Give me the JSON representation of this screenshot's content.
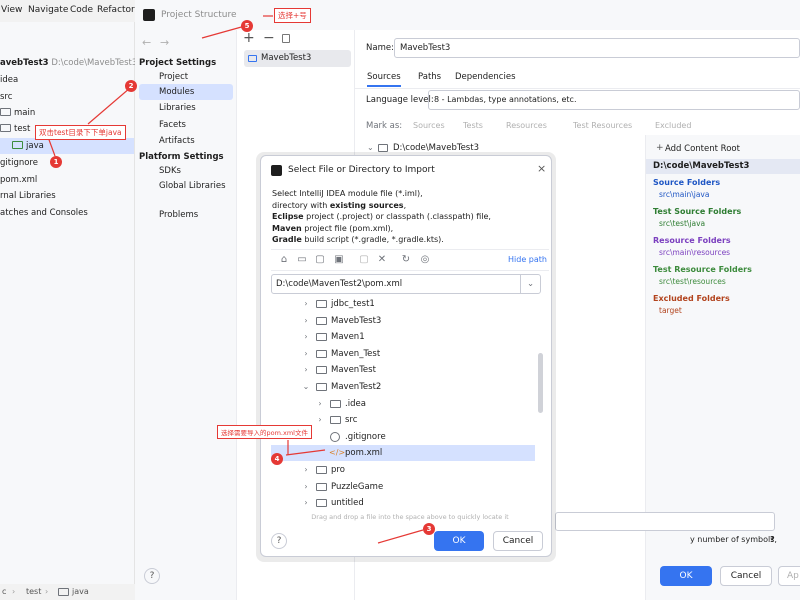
{
  "ide": {
    "menu": [
      "View",
      "Navigate",
      "Code",
      "Refactor"
    ],
    "tree": [
      {
        "label": "avebTest3",
        "suffix": "D:\\code\\MavebTest3"
      },
      {
        "label": "idea"
      },
      {
        "label": "src"
      },
      {
        "label": "main"
      },
      {
        "label": "test"
      },
      {
        "label": "java"
      },
      {
        "label": "gitignore"
      },
      {
        "label": "pom.xml"
      },
      {
        "label": "rnal Libraries"
      },
      {
        "label": "atches and Consoles"
      }
    ],
    "status": [
      "c",
      "test",
      "java"
    ]
  },
  "ps": {
    "title": "Project Structure",
    "nav_project_settings": "Project Settings",
    "nav_items_a": [
      "Project",
      "Modules",
      "Libraries",
      "Facets",
      "Artifacts"
    ],
    "nav_platform_settings": "Platform Settings",
    "nav_items_b": [
      "SDKs",
      "Global Libraries"
    ],
    "nav_problems": "Problems",
    "module": "MavebTest3",
    "name_label": "Name:",
    "name_value": "MavebTest3",
    "tabs": [
      "Sources",
      "Paths",
      "Dependencies"
    ],
    "lang_label": "Language level:",
    "lang_value": "8 - Lambdas, type annotations, etc.",
    "mark_as": "Mark as:",
    "mark_items": [
      "Sources",
      "Tests",
      "Resources",
      "Test Resources",
      "Excluded"
    ],
    "root_path": "D:\\code\\MavebTest3",
    "add_root": "Add Content Root",
    "root_bold": "D:\\code\\MavebTest3",
    "groups": [
      {
        "title": "Source Folders",
        "path": "src\\main\\java",
        "color": "#1f56c4"
      },
      {
        "title": "Test Source Folders",
        "path": "src\\test\\java",
        "color": "#2e7d32"
      },
      {
        "title": "Resource Folders",
        "path": "src\\main\\resources",
        "color": "#7b3fbf"
      },
      {
        "title": "Test Resource Folders",
        "path": "src\\test\\resources",
        "color": "#3d8b3d"
      },
      {
        "title": "Excluded Folders",
        "path": "target",
        "color": "#b2431d"
      }
    ],
    "hint": "y number of symbols,",
    "ok": "OK",
    "cancel": "Cancel",
    "apply": "Ap"
  },
  "dialog": {
    "title": "Select File or Directory to Import",
    "desc": [
      {
        "pre": "",
        "bold": "",
        "post": "Select IntelliJ IDEA module file (*.iml),"
      },
      {
        "pre": "directory with ",
        "bold": "existing sources",
        "post": ","
      },
      {
        "pre": "",
        "bold": "Eclipse",
        "post": " project (.project) or classpath (.classpath) file,"
      },
      {
        "pre": "",
        "bold": "Maven",
        "post": " project file (pom.xml),"
      },
      {
        "pre": "",
        "bold": "Gradle",
        "post": " build script (*.gradle, *.gradle.kts)."
      }
    ],
    "hide_path": "Hide path",
    "path_value": "D:\\code\\MavenTest2\\pom.xml",
    "tree": [
      {
        "label": "jdbc_test1",
        "type": "folder",
        "expand": "right",
        "indent": 0
      },
      {
        "label": "MavebTest3",
        "type": "folder",
        "expand": "right",
        "indent": 0
      },
      {
        "label": "Maven1",
        "type": "folder",
        "expand": "right",
        "indent": 0
      },
      {
        "label": "Maven_Test",
        "type": "folder",
        "expand": "right",
        "indent": 0
      },
      {
        "label": "MavenTest",
        "type": "folder",
        "expand": "right",
        "indent": 0
      },
      {
        "label": "MavenTest2",
        "type": "folder",
        "expand": "down",
        "indent": 0
      },
      {
        "label": ".idea",
        "type": "folder",
        "expand": "right",
        "indent": 1
      },
      {
        "label": "src",
        "type": "folder",
        "expand": "right",
        "indent": 1
      },
      {
        "label": ".gitignore",
        "type": "file",
        "expand": "",
        "indent": 1
      },
      {
        "label": "pom.xml",
        "type": "xml",
        "expand": "",
        "indent": 1
      },
      {
        "label": "pro",
        "type": "folder",
        "expand": "right",
        "indent": 0
      },
      {
        "label": "PuzzleGame",
        "type": "folder",
        "expand": "right",
        "indent": 0
      },
      {
        "label": "untitled",
        "type": "folder",
        "expand": "right",
        "indent": 0
      }
    ],
    "drag_hint": "Drag and drop a file into the space above to quickly locate it",
    "ok": "OK",
    "cancel": "Cancel",
    "help": "?"
  },
  "annotations": {
    "a1_text": "双击test目录下下单java",
    "a2_text": "选择+号",
    "a4_text": "选择需要导入的pom.xml文件",
    "n1": "1",
    "n2": "2",
    "n3": "3",
    "n4": "4",
    "n5": "5"
  },
  "colors": {
    "accent": "#3574f0",
    "annotation": "#e53935",
    "selection": "#d5e1ff"
  }
}
